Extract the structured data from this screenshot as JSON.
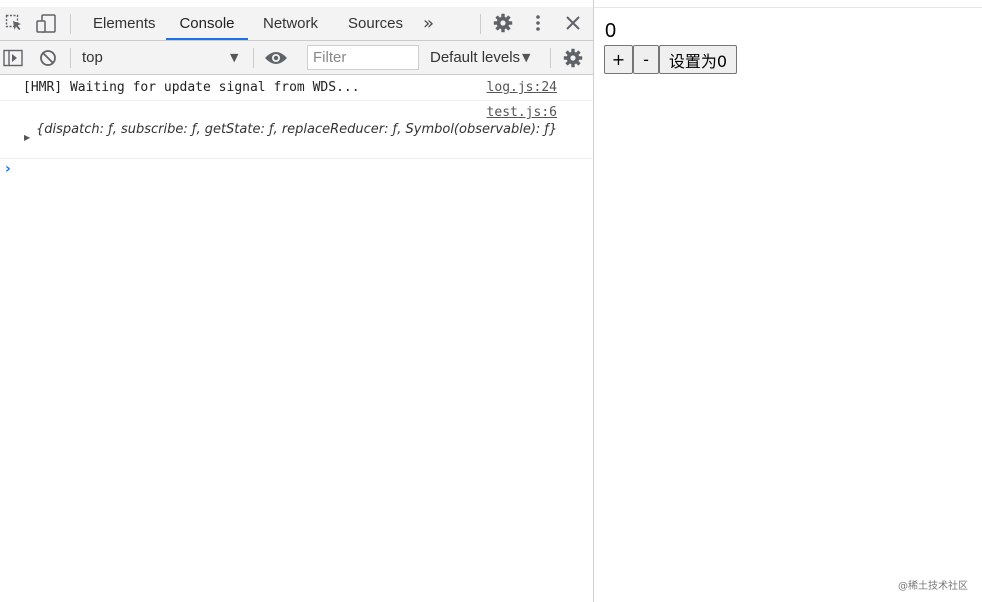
{
  "devtools": {
    "tabs": [
      {
        "label": "Elements",
        "active": false
      },
      {
        "label": "Console",
        "active": true
      },
      {
        "label": "Network",
        "active": false
      },
      {
        "label": "Sources",
        "active": false
      }
    ],
    "more_tabs": "»",
    "toolbar": {
      "context": "top",
      "filter_placeholder": "Filter",
      "levels": "Default levels"
    },
    "messages": [
      {
        "text": "[HMR] Waiting for update signal from WDS...",
        "source": "log.js:24"
      },
      {
        "text": "{dispatch: ƒ, subscribe: ƒ, getState: ƒ, replaceReducer: ƒ, Symbol(observable): ƒ}",
        "source": "test.js:6"
      }
    ],
    "accent": "#1a73e8"
  },
  "app": {
    "count": "0",
    "buttons": {
      "plus": "+",
      "minus": "-",
      "reset": "设置为0"
    }
  },
  "watermark": "@稀土技术社区"
}
